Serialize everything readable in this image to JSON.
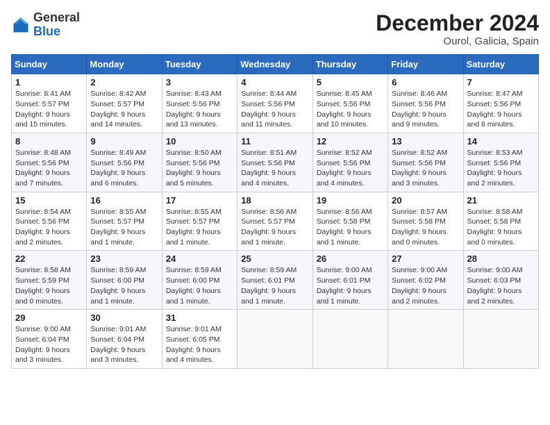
{
  "header": {
    "logo": {
      "general": "General",
      "blue": "Blue"
    },
    "title": "December 2024",
    "location": "Ourol, Galicia, Spain"
  },
  "weekdays": [
    "Sunday",
    "Monday",
    "Tuesday",
    "Wednesday",
    "Thursday",
    "Friday",
    "Saturday"
  ],
  "weeks": [
    [
      {
        "day": "1",
        "sunrise": "8:41 AM",
        "sunset": "5:57 PM",
        "daylight": "9 hours and 15 minutes."
      },
      {
        "day": "2",
        "sunrise": "8:42 AM",
        "sunset": "5:57 PM",
        "daylight": "9 hours and 14 minutes."
      },
      {
        "day": "3",
        "sunrise": "8:43 AM",
        "sunset": "5:56 PM",
        "daylight": "9 hours and 13 minutes."
      },
      {
        "day": "4",
        "sunrise": "8:44 AM",
        "sunset": "5:56 PM",
        "daylight": "9 hours and 11 minutes."
      },
      {
        "day": "5",
        "sunrise": "8:45 AM",
        "sunset": "5:56 PM",
        "daylight": "9 hours and 10 minutes."
      },
      {
        "day": "6",
        "sunrise": "8:46 AM",
        "sunset": "5:56 PM",
        "daylight": "9 hours and 9 minutes."
      },
      {
        "day": "7",
        "sunrise": "8:47 AM",
        "sunset": "5:56 PM",
        "daylight": "9 hours and 8 minutes."
      }
    ],
    [
      {
        "day": "8",
        "sunrise": "8:48 AM",
        "sunset": "5:56 PM",
        "daylight": "9 hours and 7 minutes."
      },
      {
        "day": "9",
        "sunrise": "8:49 AM",
        "sunset": "5:56 PM",
        "daylight": "9 hours and 6 minutes."
      },
      {
        "day": "10",
        "sunrise": "8:50 AM",
        "sunset": "5:56 PM",
        "daylight": "9 hours and 5 minutes."
      },
      {
        "day": "11",
        "sunrise": "8:51 AM",
        "sunset": "5:56 PM",
        "daylight": "9 hours and 4 minutes."
      },
      {
        "day": "12",
        "sunrise": "8:52 AM",
        "sunset": "5:56 PM",
        "daylight": "9 hours and 4 minutes."
      },
      {
        "day": "13",
        "sunrise": "8:52 AM",
        "sunset": "5:56 PM",
        "daylight": "9 hours and 3 minutes."
      },
      {
        "day": "14",
        "sunrise": "8:53 AM",
        "sunset": "5:56 PM",
        "daylight": "9 hours and 2 minutes."
      }
    ],
    [
      {
        "day": "15",
        "sunrise": "8:54 AM",
        "sunset": "5:56 PM",
        "daylight": "9 hours and 2 minutes."
      },
      {
        "day": "16",
        "sunrise": "8:55 AM",
        "sunset": "5:57 PM",
        "daylight": "9 hours and 1 minute."
      },
      {
        "day": "17",
        "sunrise": "8:55 AM",
        "sunset": "5:57 PM",
        "daylight": "9 hours and 1 minute."
      },
      {
        "day": "18",
        "sunrise": "8:56 AM",
        "sunset": "5:57 PM",
        "daylight": "9 hours and 1 minute."
      },
      {
        "day": "19",
        "sunrise": "8:56 AM",
        "sunset": "5:58 PM",
        "daylight": "9 hours and 1 minute."
      },
      {
        "day": "20",
        "sunrise": "8:57 AM",
        "sunset": "5:58 PM",
        "daylight": "9 hours and 0 minutes."
      },
      {
        "day": "21",
        "sunrise": "8:58 AM",
        "sunset": "5:58 PM",
        "daylight": "9 hours and 0 minutes."
      }
    ],
    [
      {
        "day": "22",
        "sunrise": "8:58 AM",
        "sunset": "5:59 PM",
        "daylight": "9 hours and 0 minutes."
      },
      {
        "day": "23",
        "sunrise": "8:59 AM",
        "sunset": "6:00 PM",
        "daylight": "9 hours and 1 minute."
      },
      {
        "day": "24",
        "sunrise": "8:59 AM",
        "sunset": "6:00 PM",
        "daylight": "9 hours and 1 minute."
      },
      {
        "day": "25",
        "sunrise": "8:59 AM",
        "sunset": "6:01 PM",
        "daylight": "9 hours and 1 minute."
      },
      {
        "day": "26",
        "sunrise": "9:00 AM",
        "sunset": "6:01 PM",
        "daylight": "9 hours and 1 minute."
      },
      {
        "day": "27",
        "sunrise": "9:00 AM",
        "sunset": "6:02 PM",
        "daylight": "9 hours and 2 minutes."
      },
      {
        "day": "28",
        "sunrise": "9:00 AM",
        "sunset": "6:03 PM",
        "daylight": "9 hours and 2 minutes."
      }
    ],
    [
      {
        "day": "29",
        "sunrise": "9:00 AM",
        "sunset": "6:04 PM",
        "daylight": "9 hours and 3 minutes."
      },
      {
        "day": "30",
        "sunrise": "9:01 AM",
        "sunset": "6:04 PM",
        "daylight": "9 hours and 3 minutes."
      },
      {
        "day": "31",
        "sunrise": "9:01 AM",
        "sunset": "6:05 PM",
        "daylight": "9 hours and 4 minutes."
      },
      null,
      null,
      null,
      null
    ]
  ]
}
